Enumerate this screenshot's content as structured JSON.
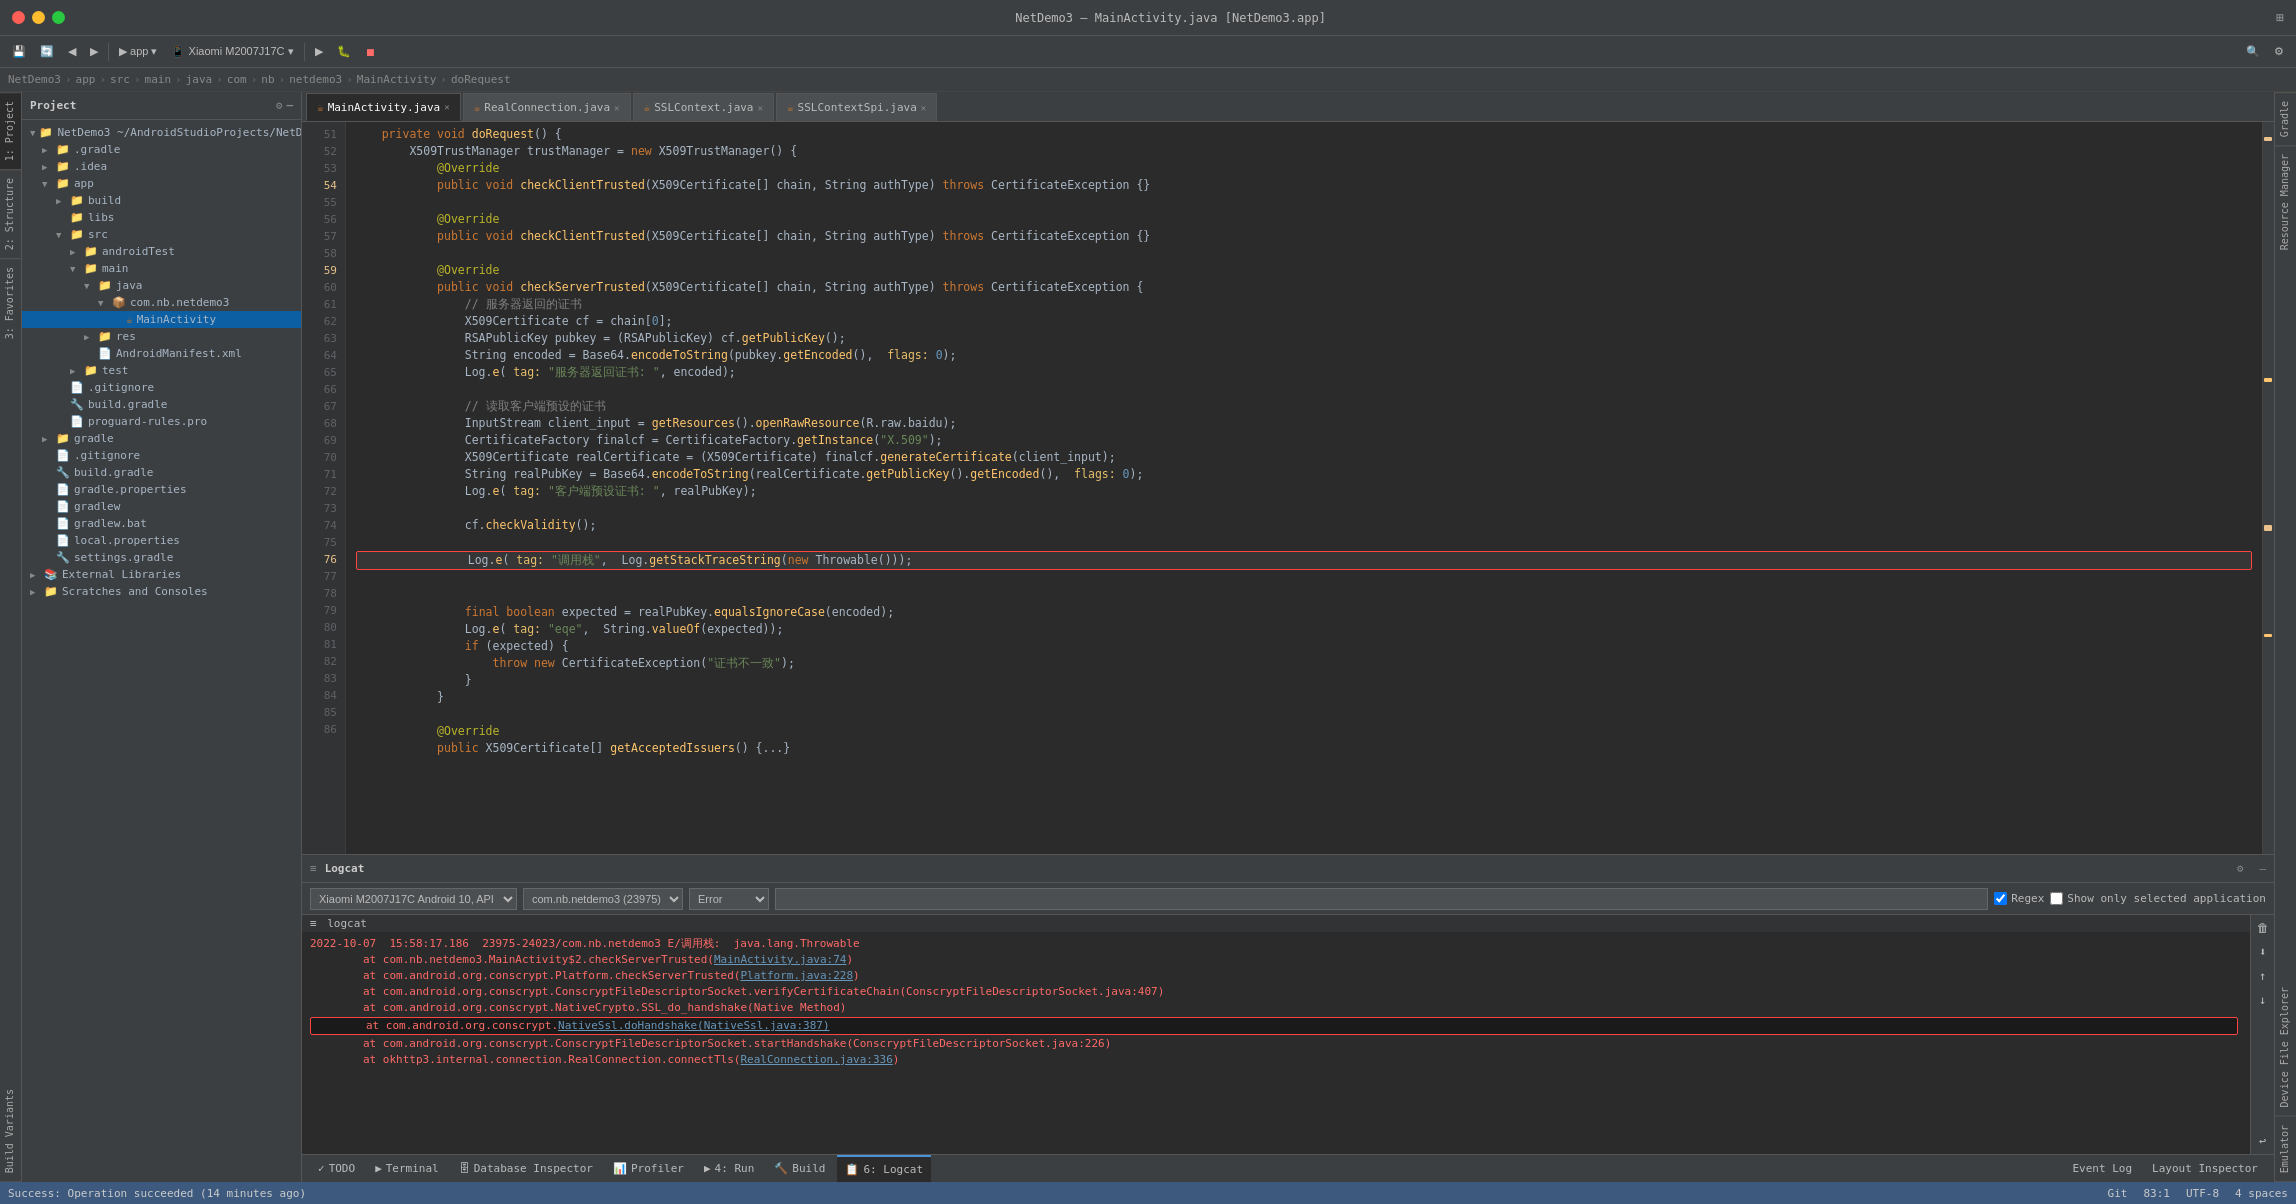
{
  "titlebar": {
    "title": "NetDemo3 – MainActivity.java [NetDemo3.app]",
    "traffic_lights": [
      "red",
      "yellow",
      "green"
    ]
  },
  "toolbar": {
    "app_label": "app",
    "device_label": "Xiaomi M2007J17C",
    "run_label": "▶",
    "debug_label": "🐛",
    "stop_label": "⏹"
  },
  "breadcrumb": {
    "items": [
      "NetDemo3",
      "app",
      "src",
      "main",
      "java",
      "com",
      "nb",
      "netdemo3",
      "MainActivity",
      "doRequest"
    ]
  },
  "sidebar": {
    "header": "Project",
    "items": [
      {
        "id": "netdemo3-root",
        "label": "NetDemo3",
        "suffix": "~/AndroidStudioProjects/NetD",
        "indent": 0,
        "type": "project",
        "expanded": true
      },
      {
        "id": "gradle-root",
        "label": ".gradle",
        "indent": 1,
        "type": "folder",
        "expanded": false
      },
      {
        "id": "idea",
        "label": ".idea",
        "indent": 1,
        "type": "folder",
        "expanded": false
      },
      {
        "id": "app",
        "label": "app",
        "indent": 1,
        "type": "folder",
        "expanded": true,
        "selected": false
      },
      {
        "id": "build",
        "label": "build",
        "indent": 2,
        "type": "folder",
        "expanded": false
      },
      {
        "id": "libs",
        "label": "libs",
        "indent": 2,
        "type": "folder",
        "expanded": false
      },
      {
        "id": "src",
        "label": "src",
        "indent": 2,
        "type": "folder",
        "expanded": true
      },
      {
        "id": "androidTest",
        "label": "androidTest",
        "indent": 3,
        "type": "folder",
        "expanded": false
      },
      {
        "id": "main",
        "label": "main",
        "indent": 3,
        "type": "folder",
        "expanded": true
      },
      {
        "id": "java",
        "label": "java",
        "indent": 4,
        "type": "folder",
        "expanded": true
      },
      {
        "id": "com.nb.netdemo3",
        "label": "com.nb.netdemo3",
        "indent": 5,
        "type": "package",
        "expanded": true
      },
      {
        "id": "MainActivity",
        "label": "MainActivity",
        "indent": 6,
        "type": "java",
        "selected": true
      },
      {
        "id": "res",
        "label": "res",
        "indent": 4,
        "type": "folder",
        "expanded": false
      },
      {
        "id": "AndroidManifest",
        "label": "AndroidManifest.xml",
        "indent": 4,
        "type": "xml"
      },
      {
        "id": "test",
        "label": "test",
        "indent": 3,
        "type": "folder",
        "expanded": false
      },
      {
        "id": "gitignore-app",
        "label": ".gitignore",
        "indent": 2,
        "type": "file"
      },
      {
        "id": "build-gradle-app",
        "label": "build.gradle",
        "indent": 2,
        "type": "gradle"
      },
      {
        "id": "proguard",
        "label": "proguard-rules.pro",
        "indent": 2,
        "type": "file"
      },
      {
        "id": "gradle",
        "label": "gradle",
        "indent": 1,
        "type": "folder",
        "expanded": false
      },
      {
        "id": "gitignore",
        "label": ".gitignore",
        "indent": 1,
        "type": "file"
      },
      {
        "id": "build-gradle",
        "label": "build.gradle",
        "indent": 1,
        "type": "gradle"
      },
      {
        "id": "gradle-props",
        "label": "gradle.properties",
        "indent": 1,
        "type": "file"
      },
      {
        "id": "gradlew",
        "label": "gradlew",
        "indent": 1,
        "type": "file"
      },
      {
        "id": "gradlew-bat",
        "label": "gradlew.bat",
        "indent": 1,
        "type": "file"
      },
      {
        "id": "local-props",
        "label": "local.properties",
        "indent": 1,
        "type": "file"
      },
      {
        "id": "settings-gradle",
        "label": "settings.gradle",
        "indent": 1,
        "type": "gradle"
      },
      {
        "id": "external-libs",
        "label": "External Libraries",
        "indent": 0,
        "type": "folder",
        "expanded": false
      },
      {
        "id": "scratches",
        "label": "Scratches and Consoles",
        "indent": 0,
        "type": "folder",
        "expanded": false
      }
    ]
  },
  "editor": {
    "tabs": [
      {
        "id": "main-activity",
        "label": "MainActivity.java",
        "active": true
      },
      {
        "id": "real-connection",
        "label": "RealConnection.java",
        "active": false
      },
      {
        "id": "ssl-context",
        "label": "SSLContext.java",
        "active": false
      },
      {
        "id": "ssl-context-spi",
        "label": "SSLContextSpi.java",
        "active": false
      }
    ],
    "code_lines": [
      {
        "num": 51,
        "content": "    private void doRequest() {"
      },
      {
        "num": 52,
        "content": "        X509TrustManager trustManager = new X509TrustManager() {"
      },
      {
        "num": 53,
        "content": "            @Override"
      },
      {
        "num": 54,
        "content": "            public void checkClientTrusted(X509Certificate[] chain, String authType) throws CertificateException {}"
      },
      {
        "num": 55,
        "content": ""
      },
      {
        "num": 56,
        "content": "            @Override"
      },
      {
        "num": 57,
        "content": "            public void checkClientTrusted(X509Certificate[] chain, String authType) throws CertificateException {}"
      },
      {
        "num": 58,
        "content": ""
      },
      {
        "num": 59,
        "content": "            @Override"
      },
      {
        "num": 60,
        "content": "            public void checkServerTrusted(X509Certificate[] chain, String authType) throws CertificateException {"
      },
      {
        "num": 61,
        "content": "                // 服务器返回的证书"
      },
      {
        "num": 62,
        "content": "                X509Certificate cf = chain[0];"
      },
      {
        "num": 63,
        "content": "                RSAPublicKey pubkey = (RSAPublicKey) cf.getPublicKey();"
      },
      {
        "num": 64,
        "content": "                String encoded = Base64.encodeToString(pubkey.getEncoded(),  flags: 0);"
      },
      {
        "num": 65,
        "content": "                Log.e( tag: \"服务器返回证书: \", encoded);"
      },
      {
        "num": 66,
        "content": ""
      },
      {
        "num": 67,
        "content": "                // 读取客户端预设的证书"
      },
      {
        "num": 68,
        "content": "                InputStream client_input = getResources().openRawResource(R.raw.baidu);"
      },
      {
        "num": 69,
        "content": "                CertificateFactory finalcf = CertificateFactory.getInstance(\"X.509\");"
      },
      {
        "num": 70,
        "content": "                X509Certificate realCertificate = (X509Certificate) finalcf.generateCertificate(client_input);"
      },
      {
        "num": 71,
        "content": "                String realPubKey = Base64.encodeToString(realCertificate.getPublicKey().getEncoded(),  flags: 0);"
      },
      {
        "num": 72,
        "content": "                Log.e( tag: \"客户端预设证书: \", realPubKey);"
      },
      {
        "num": 73,
        "content": ""
      },
      {
        "num": 74,
        "content": "                cf.checkValidity();"
      },
      {
        "num": 75,
        "content": ""
      },
      {
        "num": 76,
        "content": "                Log.e( tag: \"调用栈\",  Log.getStackTraceString(new Throwable()));",
        "highlight": true
      },
      {
        "num": 77,
        "content": ""
      },
      {
        "num": 78,
        "content": "                final boolean expected = realPubKey.equalsIgnoreCase(encoded);"
      },
      {
        "num": 79,
        "content": "                Log.e( tag: \"eqe\",  String.valueOf(expected));"
      },
      {
        "num": 80,
        "content": "                if (expected) {"
      },
      {
        "num": 81,
        "content": "                    throw new CertificateException(\"证书不一致\");"
      },
      {
        "num": 82,
        "content": "                }"
      },
      {
        "num": 83,
        "content": "            }"
      },
      {
        "num": 84,
        "content": ""
      },
      {
        "num": 85,
        "content": "            @Override"
      },
      {
        "num": 86,
        "content": "            public X509Certificate[] getAcceptedIssuers() {...}"
      }
    ]
  },
  "logcat": {
    "header_label": "Logcat",
    "device": "Xiaomi M2007J17C Android 10, API",
    "package": "com.nb.netdemo3 (23975)",
    "log_level": "Error",
    "search_placeholder": "",
    "regex_label": "Regex",
    "show_selected_label": "Show only selected application",
    "section_label": "logcat",
    "log_lines": [
      {
        "text": "2022-10-07  15:58:17.186  23975-24023/com.nb.netdemo3 E/调用栈:  java.lang.Throwable",
        "type": "error"
      },
      {
        "text": "        at com.nb.netdemo3.MainActivity$2.checkServerTrusted(MainActivity.java:74)",
        "type": "link"
      },
      {
        "text": "        at com.android.org.conscrypt.Platform.checkServerTrusted(Platform.java:228)",
        "type": "normal"
      },
      {
        "text": "        at com.android.org.conscrypt.ConscryptFileDescriptorSocket.verifyCertificateChain(ConscryptFileDescriptorSocket.java:407)",
        "type": "normal"
      },
      {
        "text": "        at com.android.org.conscrypt.NativeCrypto.SSL_do_handshake(Native Method)",
        "type": "normal"
      },
      {
        "text": "        at com.android.org.conscrypt.NativeSsl.doHandshake(NativeSsl.java:387)",
        "type": "link",
        "highlight": true
      },
      {
        "text": "        at com.android.org.conscrypt.ConscryptFileDescriptorSocket.startHandshake(ConscryptFileDescriptorSocket.java:226)",
        "type": "normal"
      },
      {
        "text": "        at okhttp3.internal.connection.RealConnection.connectTls(RealConnection.java:336)",
        "type": "link"
      }
    ],
    "status_text": "Success: Operation succeeded (14 minutes ago)"
  },
  "bottom_tabs": [
    {
      "id": "todo",
      "label": "TODO",
      "icon": "≡"
    },
    {
      "id": "terminal",
      "label": "Terminal",
      "icon": "▶"
    },
    {
      "id": "database",
      "label": "Database Inspector",
      "icon": "🗄"
    },
    {
      "id": "profiler",
      "label": "Profiler",
      "icon": "📊"
    },
    {
      "id": "run",
      "label": "4: Run",
      "icon": "▶"
    },
    {
      "id": "build",
      "label": "Build",
      "icon": "🔨"
    },
    {
      "id": "logcat",
      "label": "6: Logcat",
      "icon": "📋",
      "active": true
    }
  ],
  "right_tabs": [
    {
      "id": "event-log",
      "label": "Event Log"
    },
    {
      "id": "layout-inspector",
      "label": "Layout Inspector"
    }
  ],
  "status_bar": {
    "message": "Success: Operation succeeded (14 minutes ago)",
    "position": "83:1",
    "encoding": "UTF-8",
    "indent": "4 spaces"
  },
  "side_panel_tabs": [
    {
      "id": "project",
      "label": "1: Project"
    },
    {
      "id": "structure",
      "label": "2: Structure"
    },
    {
      "id": "favorites",
      "label": "3: Favorites"
    },
    {
      "id": "build-variants",
      "label": "Build Variants"
    }
  ],
  "right_panel_tabs": [
    {
      "id": "gradle",
      "label": "Gradle"
    },
    {
      "id": "resource-manager",
      "label": "Resource Manager"
    },
    {
      "id": "device-file-explorer",
      "label": "Device File Explorer"
    },
    {
      "id": "emulator",
      "label": "Emulator"
    }
  ]
}
